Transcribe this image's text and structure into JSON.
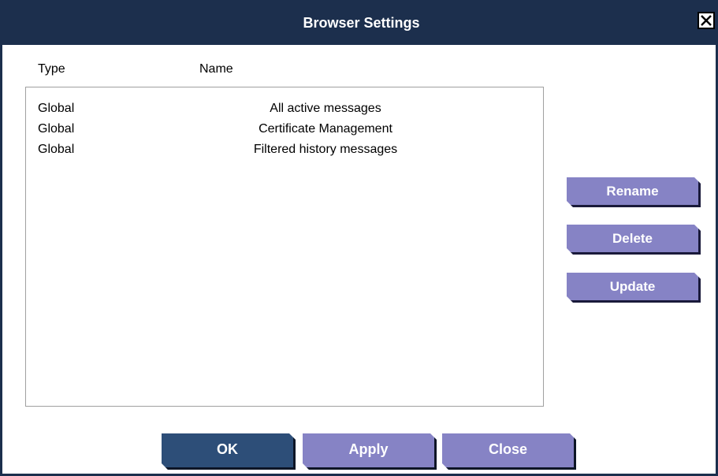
{
  "dialog": {
    "title": "Browser Settings",
    "close_icon": "close-icon"
  },
  "columns": {
    "type": "Type",
    "name": "Name"
  },
  "rows": [
    {
      "type": "Global",
      "name": "All active messages"
    },
    {
      "type": "Global",
      "name": "Certificate Management"
    },
    {
      "type": "Global",
      "name": "Filtered history messages"
    }
  ],
  "side_buttons": {
    "rename": "Rename",
    "delete": "Delete",
    "update": "Update"
  },
  "bottom_buttons": {
    "ok": "OK",
    "apply": "Apply",
    "close": "Close"
  },
  "colors": {
    "titlebar": "#1c2f4d",
    "button_primary": "#2d4e78",
    "button_secondary": "#8683c5"
  }
}
